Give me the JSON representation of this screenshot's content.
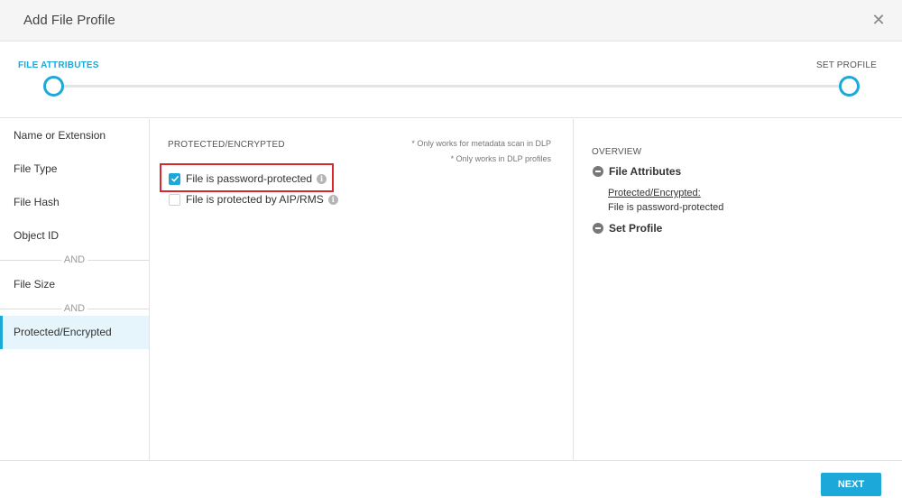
{
  "dialog": {
    "title": "Add File Profile",
    "close_icon": "close-icon"
  },
  "stepper": {
    "steps": [
      {
        "label": "FILE ATTRIBUTES",
        "state": "active"
      },
      {
        "label": "SET PROFILE",
        "state": "inactive"
      }
    ]
  },
  "sidebar": {
    "items": [
      {
        "label": "Name or Extension"
      },
      {
        "label": "File Type"
      },
      {
        "label": "File Hash"
      },
      {
        "label": "Object ID"
      },
      {
        "label": "File Size"
      },
      {
        "label": "Protected/Encrypted",
        "active": true
      }
    ],
    "separators": [
      "AND",
      "AND"
    ]
  },
  "main": {
    "section_title": "PROTECTED/ENCRYPTED",
    "notes": [
      "* Only works for metadata scan in DLP",
      "* Only works in DLP profiles"
    ],
    "options": [
      {
        "label": "File is password-protected",
        "checked": true
      },
      {
        "label": "File is protected by AIP/RMS",
        "checked": false
      }
    ],
    "info_glyph": "i"
  },
  "overview": {
    "title": "OVERVIEW",
    "groups": [
      {
        "label": "File Attributes"
      },
      {
        "label": "Set Profile"
      }
    ],
    "details": {
      "heading": "Protected/Encrypted:",
      "value": "File is password-protected"
    }
  },
  "footer": {
    "next_label": "NEXT"
  },
  "colors": {
    "accent": "#1ca8d8",
    "highlight": "#d9272e"
  }
}
